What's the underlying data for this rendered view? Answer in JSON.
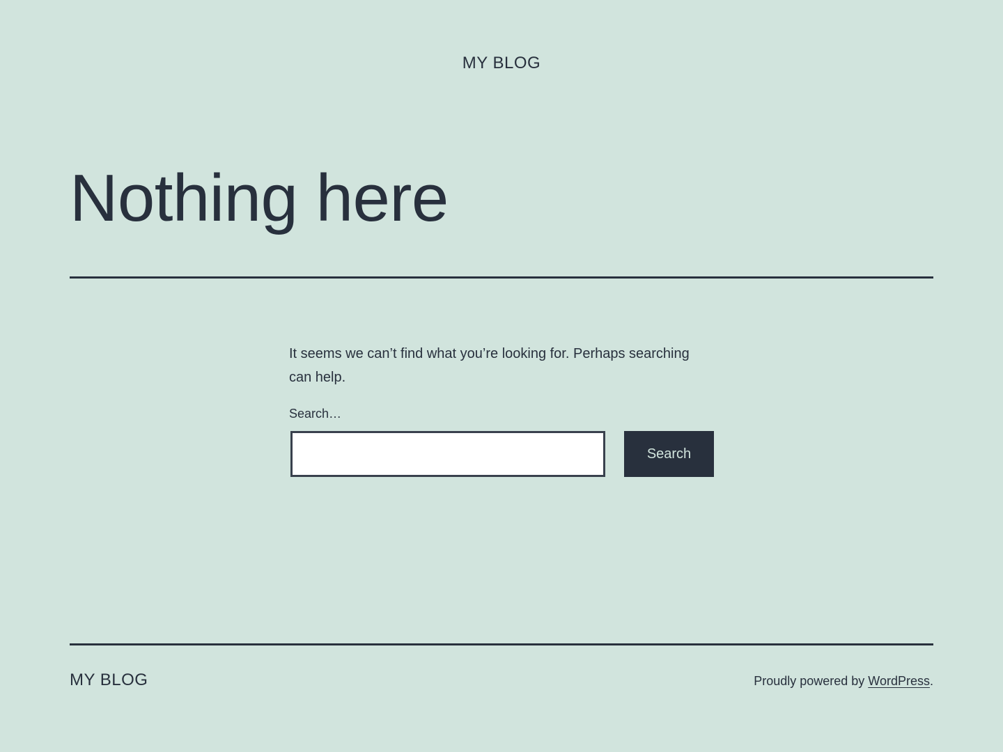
{
  "header": {
    "site_title": "MY BLOG"
  },
  "main": {
    "page_title": "Nothing here",
    "message": "It seems we can’t find what you’re looking for. Perhaps searching can help.",
    "search": {
      "label": "Search…",
      "value": "",
      "placeholder": "",
      "button_label": "Search"
    }
  },
  "footer": {
    "site_title": "MY BLOG",
    "powered_prefix": "Proudly powered by ",
    "powered_link": "WordPress",
    "powered_suffix": "."
  },
  "colors": {
    "background": "#d1e4dd",
    "text": "#28303d",
    "button_bg": "#28303d",
    "button_text": "#d1e4dd",
    "input_bg": "#ffffff"
  }
}
